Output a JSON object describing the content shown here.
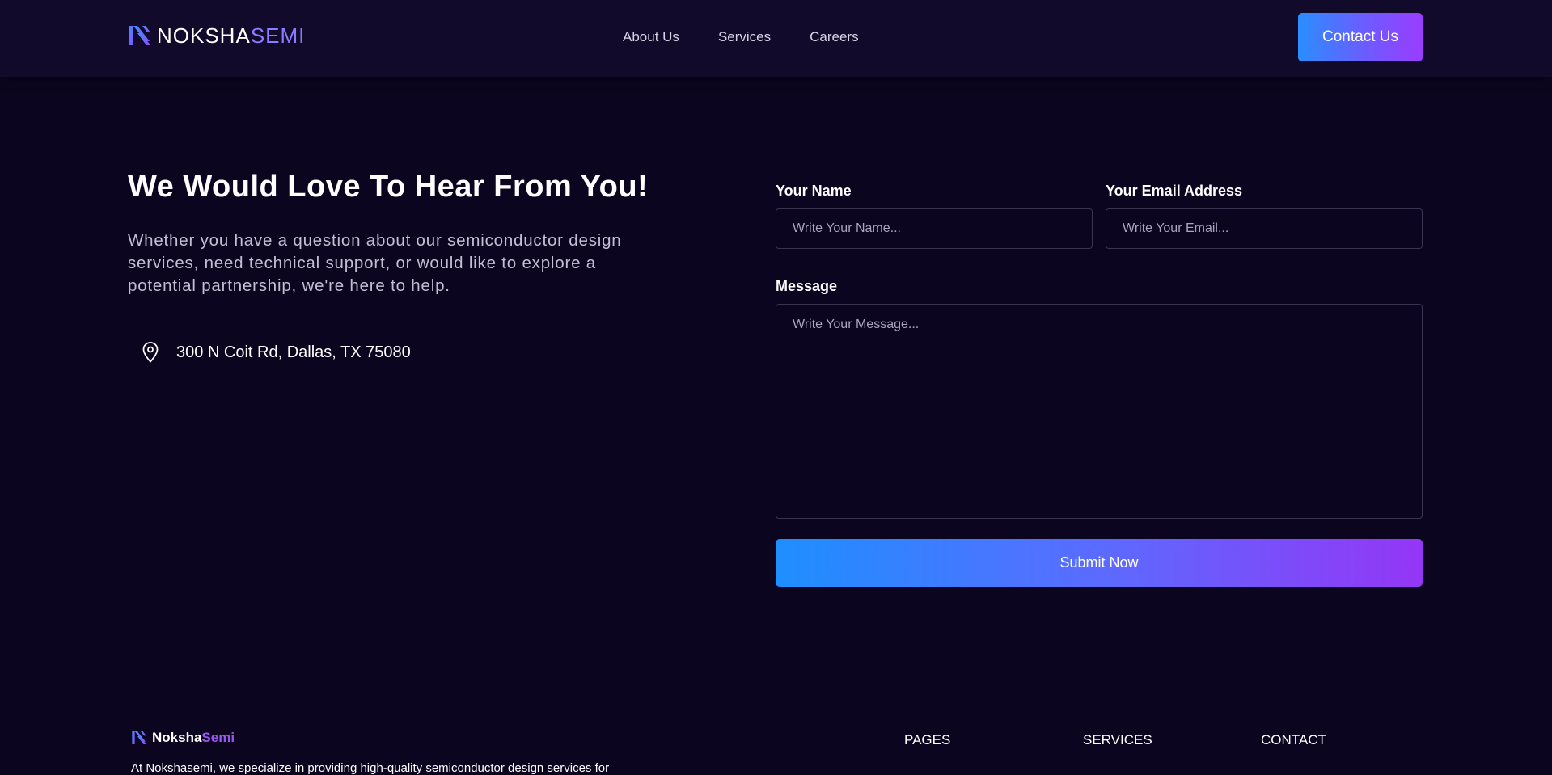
{
  "header": {
    "logo": {
      "part1": "NOKSHA",
      "part2": "SEMI",
      "icon": "noksha-logo-icon"
    },
    "nav": [
      {
        "label": "About Us"
      },
      {
        "label": "Services"
      },
      {
        "label": "Careers"
      }
    ],
    "contact_button": "Contact Us"
  },
  "intro": {
    "heading": "We Would Love To Hear From You!",
    "text": "Whether you have a question about our semiconductor design services, need technical support, or would like to explore a potential partnership, we're here to help.",
    "address": "300 N Coit Rd, Dallas, TX 75080",
    "address_icon": "map-pin-icon"
  },
  "form": {
    "name_label": "Your Name",
    "name_placeholder": "Write Your Name...",
    "email_label": "Your Email Address",
    "email_placeholder": "Write Your Email...",
    "message_label": "Message",
    "message_placeholder": "Write Your Message...",
    "submit": "Submit Now"
  },
  "footer": {
    "logo": {
      "part1": "Noksha",
      "part2": "Semi"
    },
    "description": "At Nokshasemi, we specialize in providing high-quality semiconductor design services for",
    "columns": [
      "PAGES",
      "SERVICES",
      "CONTACT"
    ]
  },
  "colors": {
    "background": "#0c0520",
    "header": "#120a2a",
    "accent_start": "#1e8fff",
    "accent_end": "#9436f5",
    "logo_accent": "#8b7bff"
  }
}
